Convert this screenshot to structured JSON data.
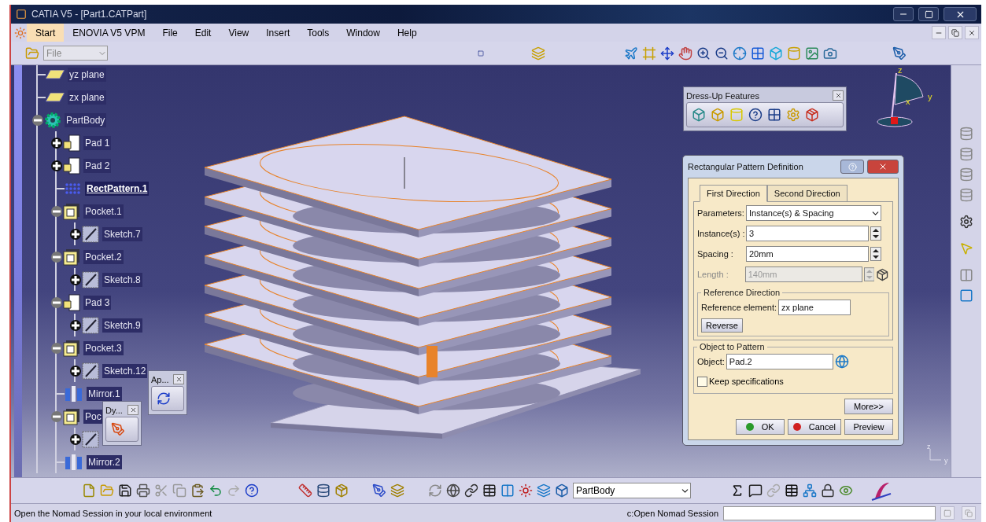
{
  "window": {
    "title": "CATIA V5 - [Part1.CATPart]"
  },
  "menu": [
    {
      "label": "Start",
      "selected": true
    },
    {
      "label": "ENOVIA V5 VPM",
      "selected": false
    },
    {
      "label": "File",
      "selected": false
    },
    {
      "label": "Edit",
      "selected": false
    },
    {
      "label": "View",
      "selected": false
    },
    {
      "label": "Insert",
      "selected": false
    },
    {
      "label": "Tools",
      "selected": false
    },
    {
      "label": "Window",
      "selected": false
    },
    {
      "label": "Help",
      "selected": false
    }
  ],
  "file_combo": {
    "value": "File",
    "disabled": true
  },
  "tree": [
    {
      "label": "yz plane",
      "kind": "plane",
      "selected": false
    },
    {
      "label": "zx plane",
      "kind": "plane",
      "selected": false
    },
    {
      "label": "PartBody",
      "kind": "body",
      "expanded": true,
      "selected": false,
      "children": [
        {
          "label": "Pad 1",
          "kind": "pad",
          "expanded": false,
          "selected": false
        },
        {
          "label": "Pad 2",
          "kind": "pad",
          "expanded": false,
          "selected": false
        },
        {
          "label": "RectPattern.1",
          "kind": "pattern",
          "selected": true
        },
        {
          "label": "Pocket.1",
          "kind": "pocket",
          "expanded": true,
          "selected": false,
          "children": [
            {
              "label": "Sketch.7",
              "kind": "sketch",
              "expanded": false,
              "selected": false
            }
          ]
        },
        {
          "label": "Pocket.2",
          "kind": "pocket",
          "expanded": true,
          "selected": false,
          "children": [
            {
              "label": "Sketch.8",
              "kind": "sketch",
              "expanded": false,
              "selected": false
            }
          ]
        },
        {
          "label": "Pad 3",
          "kind": "pad",
          "expanded": true,
          "selected": false,
          "children": [
            {
              "label": "Sketch.9",
              "kind": "sketch",
              "expanded": false,
              "selected": false
            }
          ]
        },
        {
          "label": "Pocket.3",
          "kind": "pocket",
          "expanded": true,
          "selected": false,
          "children": [
            {
              "label": "Sketch.12",
              "kind": "sketch",
              "expanded": false,
              "selected": false
            }
          ]
        },
        {
          "label": "Mirror.1",
          "kind": "mirror",
          "selected": false
        },
        {
          "label": "Poc",
          "kind": "pocket",
          "expanded": true,
          "selected": false,
          "children": [
            {
              "kind": "sketch",
              "expanded": false
            }
          ]
        },
        {
          "label": "Mirror.2",
          "kind": "mirror",
          "selected": false
        }
      ]
    }
  ],
  "dressup_toolbar": {
    "title": "Dress-Up Features"
  },
  "apply_toolbar": {
    "title": "Ap..."
  },
  "dy_toolbar": {
    "title": "Dy..."
  },
  "compass": {
    "labels": [
      "z",
      "x",
      "y"
    ]
  },
  "corner_axes": {
    "labels": [
      "z",
      "y"
    ]
  },
  "dialog": {
    "title": "Rectangular Pattern Definition",
    "tabs": [
      {
        "label": "First Direction",
        "selected": true
      },
      {
        "label": "Second Direction",
        "selected": false
      }
    ],
    "fields": [
      {
        "label": "Parameters:",
        "value": "Instance(s) & Spacing",
        "kind": "dropdown",
        "disabled": false
      },
      {
        "label": "Instance(s) :",
        "value": "3",
        "kind": "spinner",
        "disabled": false
      },
      {
        "label": "Spacing :",
        "value": "20mm",
        "kind": "spinner",
        "disabled": false
      },
      {
        "label": "Length :",
        "value": "140mm",
        "kind": "spinner",
        "disabled": true
      }
    ],
    "reference": {
      "title": "Reference Direction",
      "label": "Reference element:",
      "value": "zx plane",
      "button": "Reverse"
    },
    "object": {
      "title": "Object to Pattern",
      "label": "Object:",
      "value": "Pad.2",
      "keep_label": "Keep specifications",
      "keep_checked": false
    },
    "more_button": "More>>",
    "buttons": [
      {
        "label": "OK",
        "kind": "ok"
      },
      {
        "label": "Cancel",
        "kind": "cancel"
      },
      {
        "label": "Preview",
        "kind": "plain"
      }
    ]
  },
  "bottom_toolbar": {
    "body_select": "PartBody"
  },
  "status_bar": {
    "message": "Open the Nomad Session in your local environment",
    "command_label": "c:Open Nomad Session"
  }
}
